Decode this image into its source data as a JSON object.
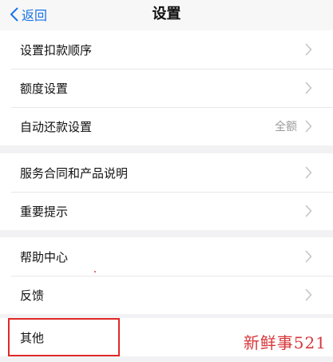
{
  "navbar": {
    "back_label": "返回",
    "title": "设置"
  },
  "groups": [
    {
      "items": [
        {
          "label": "设置扣款顺序",
          "value": ""
        },
        {
          "label": "额度设置",
          "value": ""
        },
        {
          "label": "自动还款设置",
          "value": "全额"
        }
      ]
    },
    {
      "items": [
        {
          "label": "服务合同和产品说明",
          "value": ""
        },
        {
          "label": "重要提示",
          "value": ""
        }
      ]
    },
    {
      "items": [
        {
          "label": "帮助中心",
          "value": ""
        },
        {
          "label": "反馈",
          "value": ""
        }
      ]
    },
    {
      "items": [
        {
          "label": "其他",
          "value": ""
        }
      ]
    }
  ],
  "watermark": "新鲜事521",
  "colors": {
    "accent": "#1a73e8",
    "highlight": "#e02828",
    "watermark": "#d8363a"
  }
}
